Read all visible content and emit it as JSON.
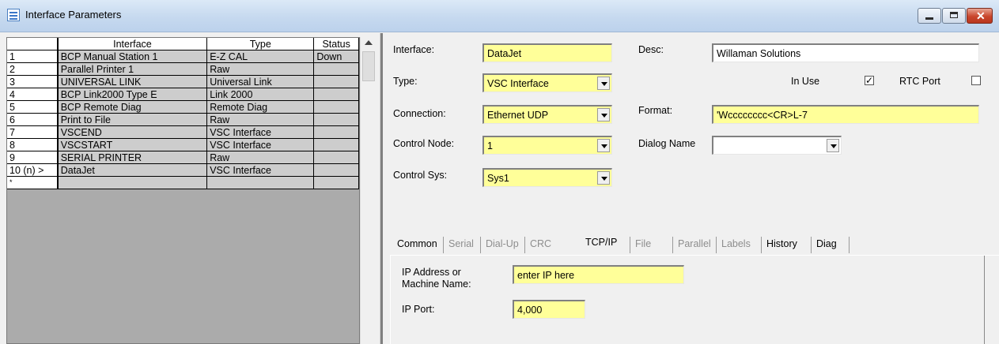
{
  "window": {
    "title": "Interface Parameters"
  },
  "grid": {
    "columns": [
      "Interface",
      "Type",
      "Status"
    ],
    "rows": [
      {
        "id": "1",
        "interface": "BCP Manual Station 1",
        "type": "E-Z CAL",
        "status": "Down"
      },
      {
        "id": "2",
        "interface": "Parallel Printer 1",
        "type": "Raw",
        "status": ""
      },
      {
        "id": "3",
        "interface": "UNIVERSAL LINK",
        "type": "Universal Link",
        "status": ""
      },
      {
        "id": "4",
        "interface": "BCP Link2000 Type E",
        "type": "Link 2000",
        "status": ""
      },
      {
        "id": "5",
        "interface": "BCP Remote Diag",
        "type": "Remote Diag",
        "status": ""
      },
      {
        "id": "6",
        "interface": "Print to File",
        "type": "Raw",
        "status": ""
      },
      {
        "id": "7",
        "interface": "VSCEND",
        "type": "VSC Interface",
        "status": ""
      },
      {
        "id": "8",
        "interface": "VSCSTART",
        "type": "VSC Interface",
        "status": ""
      },
      {
        "id": "9",
        "interface": "SERIAL PRINTER",
        "type": "Raw",
        "status": ""
      },
      {
        "id": "10 (n) >",
        "interface": "DataJet",
        "type": "VSC Interface",
        "status": ""
      }
    ],
    "new_row_marker": "*"
  },
  "form": {
    "interface_label": "Interface:",
    "interface_value": "DataJet",
    "desc_label": "Desc:",
    "desc_value": "Willaman Solutions",
    "type_label": "Type:",
    "type_value": "VSC Interface",
    "in_use_label": "In Use",
    "in_use_checked": "✓",
    "rtc_port_label": "RTC Port",
    "connection_label": "Connection:",
    "connection_value": "Ethernet UDP",
    "format_label": "Format:",
    "format_value": "'Wcccccccc<CR>L-7",
    "control_node_label": "Control Node:",
    "control_node_value": "1",
    "dialog_name_label": "Dialog Name",
    "dialog_name_value": "",
    "control_sys_label": "Control Sys:",
    "control_sys_value": "Sys1"
  },
  "tabs": [
    "Common",
    "Serial",
    "Dial-Up",
    "CRC",
    "TCP/IP",
    "File",
    "Parallel",
    "Labels",
    "History",
    "Diag"
  ],
  "tcpip": {
    "ip_label_line1": "IP Address or",
    "ip_label_line2": "Machine Name:",
    "ip_value": "enter IP here",
    "port_label": "IP Port:",
    "port_value": "4,000"
  },
  "colors": {
    "field_highlight": "#ffff99",
    "close_button": "#c9462c"
  }
}
